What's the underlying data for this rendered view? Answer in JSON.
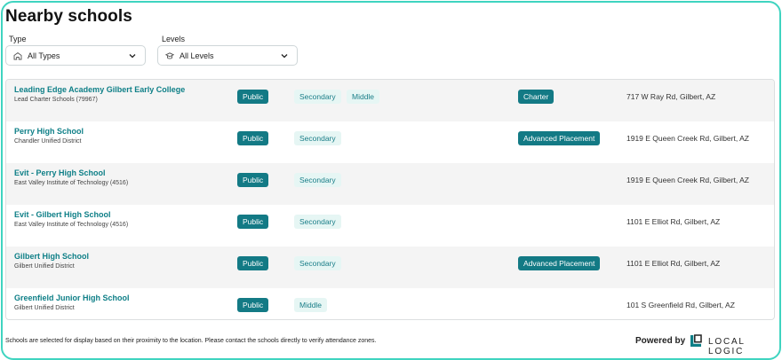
{
  "header": {
    "title": "Nearby schools"
  },
  "filters": {
    "type": {
      "label": "Type",
      "value": "All Types",
      "icon": "school-building-icon"
    },
    "levels": {
      "label": "Levels",
      "value": "All Levels",
      "icon": "graduation-cap-icon"
    }
  },
  "colors": {
    "accent": "#0e7f87",
    "badge_solid": "#137a85",
    "badge_light": "#e6f6f4",
    "frame": "#3fd4c0"
  },
  "schools": [
    {
      "name": "Leading Edge Academy Gilbert Early College",
      "district": "Lead Charter Schools (79967)",
      "type": "Public",
      "levels": [
        "Secondary",
        "Middle"
      ],
      "program": "Charter",
      "address": "717 W Ray Rd, Gilbert, AZ"
    },
    {
      "name": "Perry High School",
      "district": "Chandler Unified District",
      "type": "Public",
      "levels": [
        "Secondary"
      ],
      "program": "Advanced Placement",
      "address": "1919 E Queen Creek Rd, Gilbert, AZ"
    },
    {
      "name": "Evit - Perry High School",
      "district": "East Valley Institute of Technology (4516)",
      "type": "Public",
      "levels": [
        "Secondary"
      ],
      "program": "",
      "address": "1919 E Queen Creek Rd, Gilbert, AZ"
    },
    {
      "name": "Evit - Gilbert High School",
      "district": "East Valley Institute of Technology (4516)",
      "type": "Public",
      "levels": [
        "Secondary"
      ],
      "program": "",
      "address": "1101 E Elliot Rd, Gilbert, AZ"
    },
    {
      "name": "Gilbert High School",
      "district": "Gilbert Unified District",
      "type": "Public",
      "levels": [
        "Secondary"
      ],
      "program": "Advanced Placement",
      "address": "1101 E Elliot Rd, Gilbert, AZ"
    },
    {
      "name": "Greenfield Junior High School",
      "district": "Gilbert Unified District",
      "type": "Public",
      "levels": [
        "Middle"
      ],
      "program": "",
      "address": "101 S Greenfield Rd, Gilbert, AZ"
    }
  ],
  "footer": {
    "note": "Schools are selected for display based on their proximity to the location. Please contact the schools directly to verify attendance zones.",
    "powered_by": "Powered by",
    "brand": "LOCAL LOGIC"
  }
}
